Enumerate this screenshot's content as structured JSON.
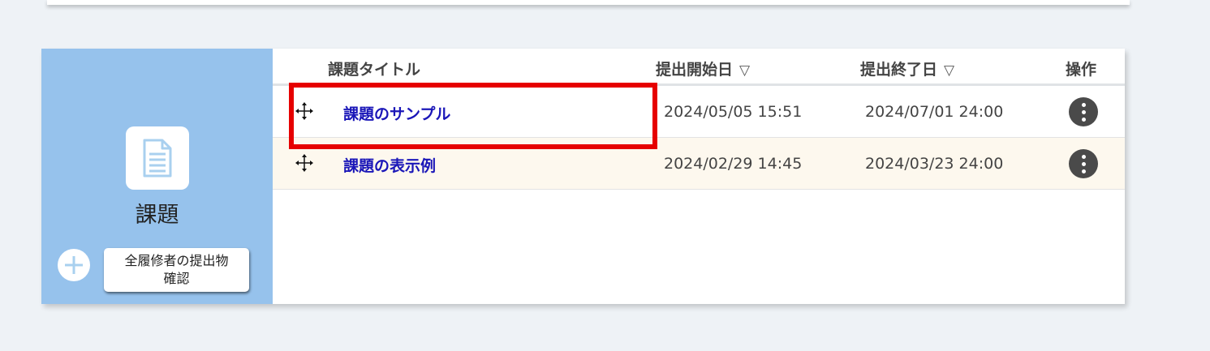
{
  "sidebar": {
    "icon": "document-icon",
    "title": "課題",
    "add_icon": "plus-icon",
    "confirm_button": {
      "line1": "全履修者の提出物",
      "line2": "確認"
    }
  },
  "table": {
    "headers": {
      "title": "課題タイトル",
      "start": "提出開始日",
      "end": "提出終了日",
      "actions": "操作",
      "sort_icon": "▽"
    },
    "rows": [
      {
        "title": "課題のサンプル",
        "start": "2024/05/05 15:51",
        "end": "2024/07/01 24:00",
        "highlighted": true
      },
      {
        "title": "課題の表示例",
        "start": "2024/02/29 14:45",
        "end": "2024/03/23 24:00",
        "highlighted": false
      }
    ]
  },
  "colors": {
    "sidebar_bg": "#96c2ec",
    "link": "#1a16b8",
    "highlight_border": "#e60000",
    "alt_row_bg": "#fdf8ee",
    "action_button": "#4a4a4a"
  }
}
